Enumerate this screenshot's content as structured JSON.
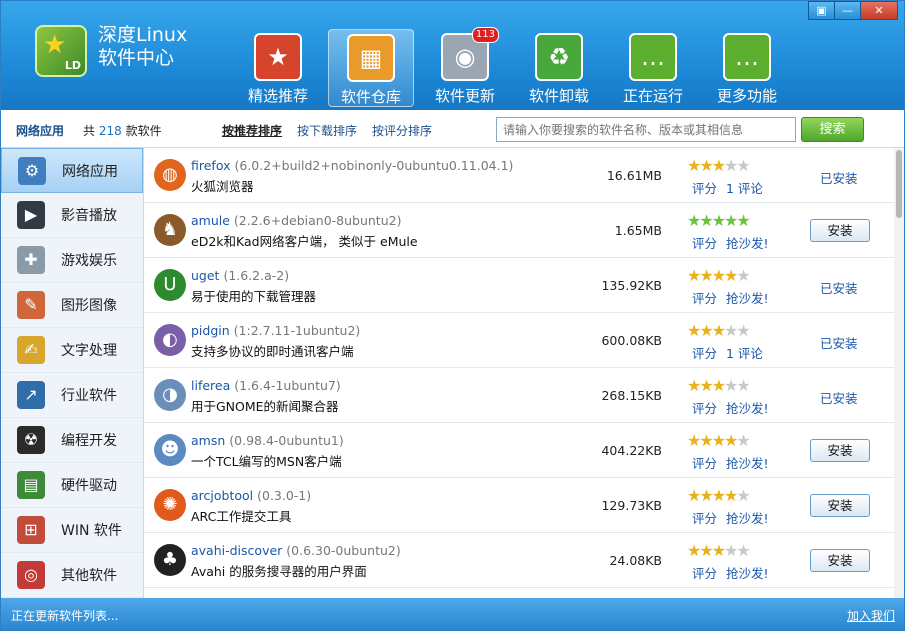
{
  "app": {
    "title_line1": "深度Linux",
    "title_line2": "软件中心",
    "logo_text": "LD"
  },
  "window_controls": [
    "▣",
    "—",
    "✕"
  ],
  "nav": [
    {
      "label": "精选推荐",
      "icon": "star-icon",
      "color": "#d6452b",
      "glyph": "★"
    },
    {
      "label": "软件仓库",
      "icon": "repository-icon",
      "color": "#e89a2a",
      "glyph": "▦",
      "active": true
    },
    {
      "label": "软件更新",
      "icon": "update-disc-icon",
      "color": "#9aa7b3",
      "glyph": "◉",
      "badge": "113"
    },
    {
      "label": "软件卸载",
      "icon": "recycle-icon",
      "color": "#48a83c",
      "glyph": "♻"
    },
    {
      "label": "正在运行",
      "icon": "chat-bubble-icon",
      "color": "#5cae2e",
      "glyph": "…"
    },
    {
      "label": "更多功能",
      "icon": "chat-bubble-icon",
      "color": "#5cae2e",
      "glyph": "…"
    }
  ],
  "toolbar": {
    "category": "网络应用",
    "count_prefix": "共",
    "count": "218",
    "count_suffix": "款软件",
    "sort_recommended": "按推荐排序",
    "sort_downloads": "按下载排序",
    "sort_rating": "按评分排序",
    "search_placeholder": "请输入你要搜索的软件名称、版本或其相信息",
    "search_button": "搜索"
  },
  "sidebar": [
    {
      "label": "网络应用",
      "icon": "network-icon",
      "color": "#3f7fc0",
      "glyph": "⚙",
      "active": true
    },
    {
      "label": "影音播放",
      "icon": "film-clapper-icon",
      "color": "#333a45",
      "glyph": "▶"
    },
    {
      "label": "游戏娱乐",
      "icon": "gamepad-icon",
      "color": "#8a9aa6",
      "glyph": "✚"
    },
    {
      "label": "图形图像",
      "icon": "palette-icon",
      "color": "#d0663a",
      "glyph": "✎"
    },
    {
      "label": "文字处理",
      "icon": "notepad-pencil-icon",
      "color": "#d8a62a",
      "glyph": "✍"
    },
    {
      "label": "行业软件",
      "icon": "chart-icon",
      "color": "#2f6ea8",
      "glyph": "↗"
    },
    {
      "label": "编程开发",
      "icon": "radiation-icon",
      "color": "#2b2b2b",
      "glyph": "☢"
    },
    {
      "label": "硬件驱动",
      "icon": "circuit-board-icon",
      "color": "#3c8a3a",
      "glyph": "▤"
    },
    {
      "label": "WIN 软件",
      "icon": "windows-logo-icon",
      "color": "#c24b3a",
      "glyph": "⊞"
    },
    {
      "label": "其他软件",
      "icon": "disc-icon",
      "color": "#c33a3a",
      "glyph": "◎"
    }
  ],
  "apps": [
    {
      "name": "firefox",
      "version": "(6.0.2+build2+nobinonly-0ubuntu0.11.04.1)",
      "desc": "火狐浏览器",
      "size": "16.61MB",
      "stars": 3,
      "green": false,
      "rate_label": "评分",
      "comment": "1 评论",
      "status": "已安装",
      "installed": true,
      "icon": "firefox-icon",
      "color": "#e0661f",
      "glyph": "◍"
    },
    {
      "name": "amule",
      "version": "(2.2.6+debian0-8ubuntu2)",
      "desc": "eD2k和Kad网络客户端， 类似于 eMule",
      "size": "1.65MB",
      "stars": 5,
      "green": true,
      "rate_label": "评分",
      "comment": "抢沙发!",
      "status": "安装",
      "installed": false,
      "icon": "mule-icon",
      "color": "#8a5a2a",
      "glyph": "♞"
    },
    {
      "name": "uget",
      "version": "(1.6.2.a-2)",
      "desc": "易于使用的下载管理器",
      "size": "135.92KB",
      "stars": 3.5,
      "green": false,
      "rate_label": "评分",
      "comment": "抢沙发!",
      "status": "已安装",
      "installed": true,
      "icon": "magnet-icon",
      "color": "#2e8a2e",
      "glyph": "U"
    },
    {
      "name": "pidgin",
      "version": "(1:2.7.11-1ubuntu2)",
      "desc": "支持多协议的即时通讯客户端",
      "size": "600.08KB",
      "stars": 2.5,
      "green": false,
      "rate_label": "评分",
      "comment": "1 评论",
      "status": "已安装",
      "installed": true,
      "icon": "pidgin-bird-icon",
      "color": "#7a5fa8",
      "glyph": "◐"
    },
    {
      "name": "liferea",
      "version": "(1.6.4-1ubuntu7)",
      "desc": "用于GNOME的新闻聚合器",
      "size": "268.15KB",
      "stars": 2.5,
      "green": false,
      "rate_label": "评分",
      "comment": "抢沙发!",
      "status": "已安装",
      "installed": true,
      "icon": "newspaper-globe-icon",
      "color": "#6b8fb8",
      "glyph": "◑"
    },
    {
      "name": "amsn",
      "version": "(0.98.4-0ubuntu1)",
      "desc": "一个TCL编写的MSN客户端",
      "size": "404.22KB",
      "stars": 4,
      "green": false,
      "rate_label": "评分",
      "comment": "抢沙发!",
      "status": "安装",
      "installed": false,
      "icon": "contacts-icon",
      "color": "#5a8ac0",
      "glyph": "☻"
    },
    {
      "name": "arcjobtool",
      "version": "(0.3.0-1)",
      "desc": "ARC工作提交工具",
      "size": "129.73KB",
      "stars": 4,
      "green": false,
      "rate_label": "评分",
      "comment": "抢沙发!",
      "status": "安装",
      "installed": false,
      "icon": "arc-logo-icon",
      "color": "#e05a1c",
      "glyph": "✺"
    },
    {
      "name": "avahi-discover",
      "version": "(0.6.30-0ubuntu2)",
      "desc": "Avahi 的服务搜寻器的用户界面",
      "size": "24.08KB",
      "stars": 2.5,
      "green": false,
      "rate_label": "评分",
      "comment": "抢沙发!",
      "status": "安装",
      "installed": false,
      "icon": "tux-penguin-icon",
      "color": "#222",
      "glyph": "♣"
    }
  ],
  "status_bar": {
    "left": "正在更新软件列表...",
    "right": "加入我们"
  }
}
